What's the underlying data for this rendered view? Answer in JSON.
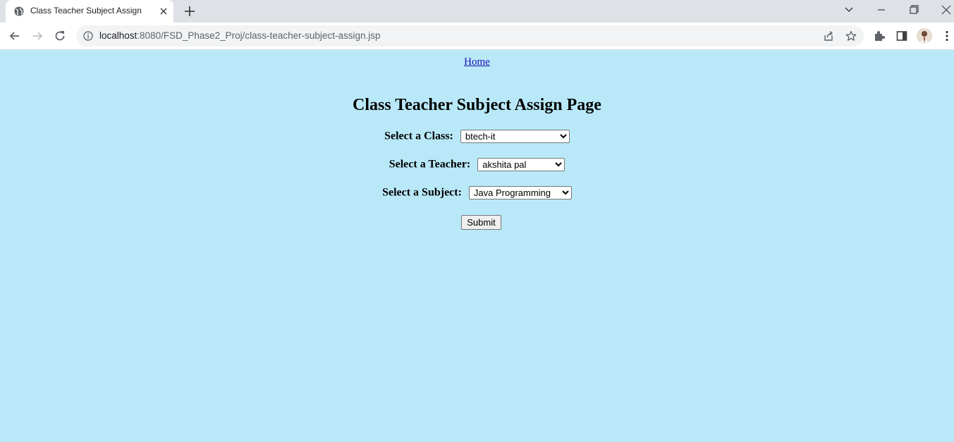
{
  "browser": {
    "tab_title": "Class Teacher Subject Assign",
    "url_host": "localhost",
    "url_rest": ":8080/FSD_Phase2_Proj/class-teacher-subject-assign.jsp"
  },
  "page": {
    "home_link": "Home",
    "title": "Class Teacher Subject Assign Page",
    "class_label": "Select a Class:",
    "class_selected": "btech-it",
    "teacher_label": "Select a Teacher:",
    "teacher_selected": "akshita pal",
    "subject_label": "Select a Subject:",
    "subject_selected": "Java Programming",
    "submit_label": "Submit"
  },
  "colors": {
    "page_background": "#b9e9f9",
    "tabbar": "#dee1e6"
  }
}
